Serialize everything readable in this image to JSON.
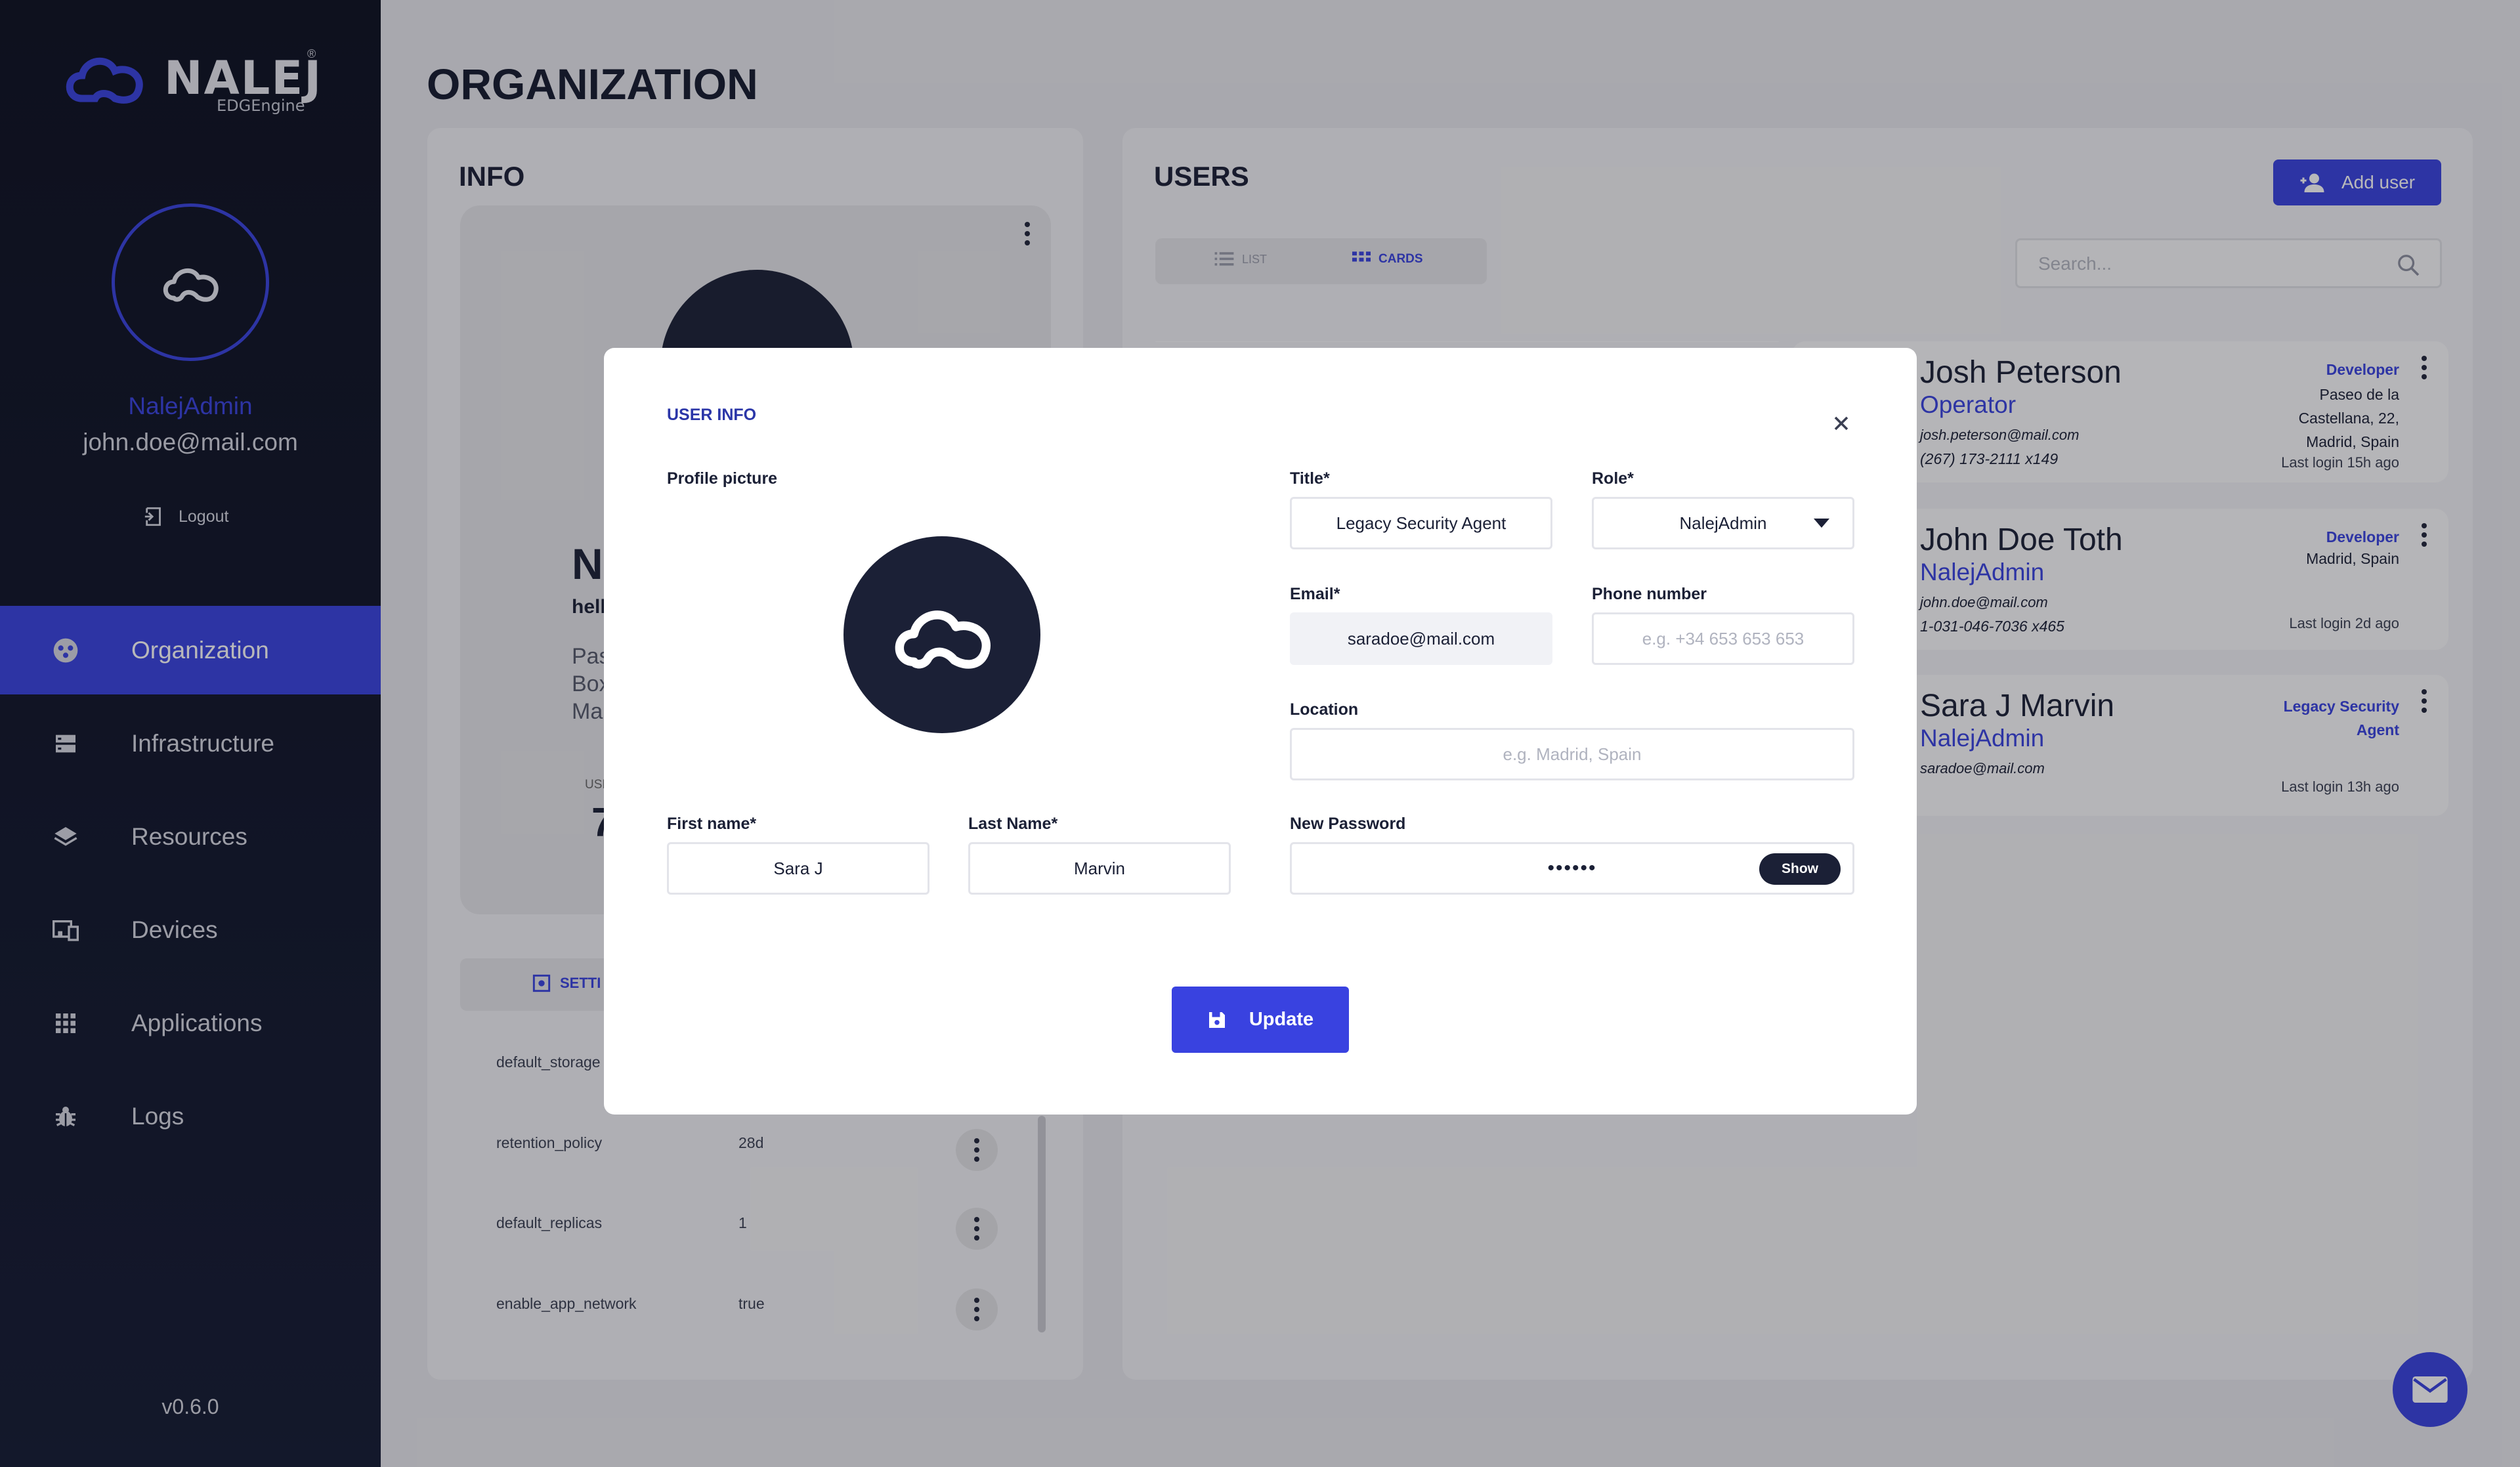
{
  "brand": {
    "name": "NALEJ",
    "sub": "EDGEngine",
    "reg": "®"
  },
  "user": {
    "name": "NalejAdmin",
    "email": "john.doe@mail.com",
    "logout": "Logout"
  },
  "nav": [
    {
      "label": "Organization",
      "icon": "organization-icon",
      "active": true
    },
    {
      "label": "Infrastructure",
      "icon": "server-icon",
      "active": false
    },
    {
      "label": "Resources",
      "icon": "layers-icon",
      "active": false
    },
    {
      "label": "Devices",
      "icon": "devices-icon",
      "active": false
    },
    {
      "label": "Applications",
      "icon": "apps-grid-icon",
      "active": false
    },
    {
      "label": "Logs",
      "icon": "bug-icon",
      "active": false
    }
  ],
  "version": "v0.6.0",
  "page": {
    "title": "ORGANIZATION"
  },
  "info": {
    "title": "INFO",
    "partial": {
      "name": "N",
      "hello": "hell",
      "addr1": "Pas",
      "addr2": "Box",
      "addr3": "Ma",
      "users_label": "USE",
      "users_val": "7"
    },
    "settings_tab": "SETTI",
    "settings": [
      {
        "key": "default_storage",
        "value": ""
      },
      {
        "key": "retention_policy",
        "value": "28d"
      },
      {
        "key": "default_replicas",
        "value": "1"
      },
      {
        "key": "enable_app_network",
        "value": "true"
      }
    ]
  },
  "users": {
    "title": "USERS",
    "add_button": "Add user",
    "view_list": "LIST",
    "view_cards": "CARDS",
    "search_placeholder": "Search...",
    "cards": [
      {
        "name": "Josh Peterson",
        "role": "Operator",
        "email": "josh.peterson@mail.com",
        "phone": "(267) 173-2111 x149",
        "title": "Developer",
        "location": "Paseo de la Castellana, 22, Madrid, Spain",
        "last_login": "Last login 15h ago"
      },
      {
        "name": "John Doe Toth",
        "role": "NalejAdmin",
        "email": "john.doe@mail.com",
        "phone": "1-031-046-7036 x465",
        "title": "Developer",
        "location": "Madrid, Spain",
        "last_login": "Last login 2d ago"
      },
      {
        "name": "Sara J Marvin",
        "role": "NalejAdmin",
        "email": "saradoe@mail.com",
        "phone": "",
        "title": "Legacy Security Agent",
        "location": "",
        "last_login": "Last login 13h ago"
      }
    ]
  },
  "modal": {
    "heading": "USER INFO",
    "profile_label": "Profile picture",
    "title_label": "Title*",
    "title_value": "Legacy Security Agent",
    "role_label": "Role*",
    "role_value": "NalejAdmin",
    "email_label": "Email*",
    "email_value": "saradoe@mail.com",
    "phone_label": "Phone number",
    "phone_placeholder": "e.g. +34 653 653 653",
    "location_label": "Location",
    "location_placeholder": "e.g. Madrid, Spain",
    "first_label": "First name*",
    "first_value": "Sara J",
    "last_label": "Last Name*",
    "last_value": "Marvin",
    "password_label": "New Password",
    "password_value": "••••••",
    "show_button": "Show",
    "update_button": "Update"
  },
  "colors": {
    "accent": "#3942e0",
    "sidebar": "#0c1020",
    "dark": "#1b2036"
  }
}
